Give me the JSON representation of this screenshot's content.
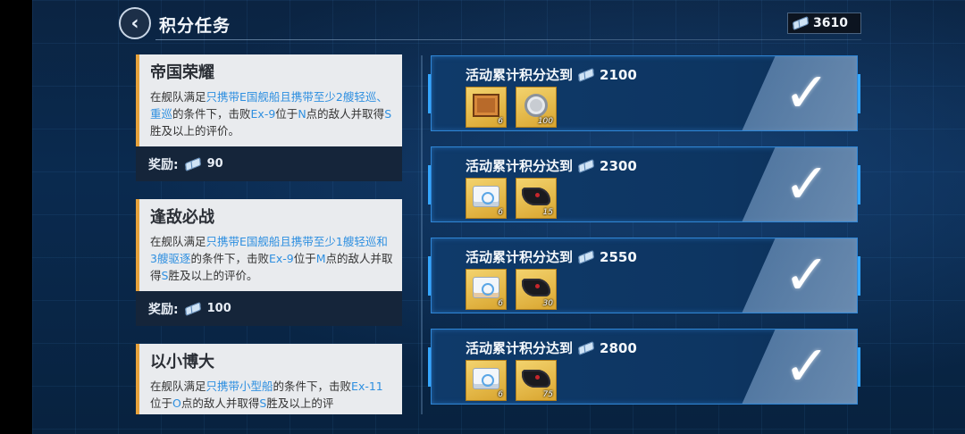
{
  "header": {
    "title": "积分任务",
    "back_icon": "back-chevron-icon",
    "points": "3610"
  },
  "tasks": [
    {
      "name": "帝国荣耀",
      "desc_parts": [
        "在舰队满足",
        "只携带E国舰船且携带至少2艘轻巡、重巡",
        "的条件下，击败",
        "Ex-9",
        "位于",
        "N",
        "点的敌人并取得",
        "S",
        "胜及以上的评价。"
      ],
      "reward_label": "奖励:",
      "reward_amount": "90"
    },
    {
      "name": "逢敌必战",
      "desc_parts": [
        "在舰队满足",
        "只携带E国舰船且携带至少1艘轻巡和3艘驱逐",
        "的条件下，击败",
        "Ex-9",
        "位于",
        "M",
        "点的敌人并取得",
        "S",
        "胜及以上的评价。"
      ],
      "reward_label": "奖励:",
      "reward_amount": "100"
    },
    {
      "name": "以小博大",
      "desc_parts": [
        "在舰队满足",
        "只携带小型船",
        "的条件下，击败",
        "Ex-11",
        "位于",
        "O",
        "点的敌人并取得",
        "S",
        "胜及以上的评"
      ],
      "reward_label": "",
      "reward_amount": ""
    }
  ],
  "milestones": [
    {
      "label": "活动累计积分达到",
      "points": "2100",
      "items": [
        {
          "icon": "crate-icon",
          "count": "6"
        },
        {
          "icon": "coin-icon",
          "count": "100"
        }
      ],
      "completed": true
    },
    {
      "label": "活动累计积分达到",
      "points": "2300",
      "items": [
        {
          "icon": "blue-box-icon",
          "count": "6"
        },
        {
          "icon": "mask-icon",
          "count": "15"
        }
      ],
      "completed": true
    },
    {
      "label": "活动累计积分达到",
      "points": "2550",
      "items": [
        {
          "icon": "orange-box-icon",
          "count": "6"
        },
        {
          "icon": "mask-icon",
          "count": "30"
        }
      ],
      "completed": true
    },
    {
      "label": "活动累计积分达到",
      "points": "2800",
      "items": [
        {
          "icon": "blue-box-icon",
          "count": "6"
        },
        {
          "icon": "mask-icon",
          "count": "75"
        }
      ],
      "completed": true
    }
  ],
  "check_glyph": "✓",
  "colors": {
    "accent": "#2e8fe0",
    "task_border": "#e6a23c",
    "milestone_border": "#2f86d6"
  }
}
